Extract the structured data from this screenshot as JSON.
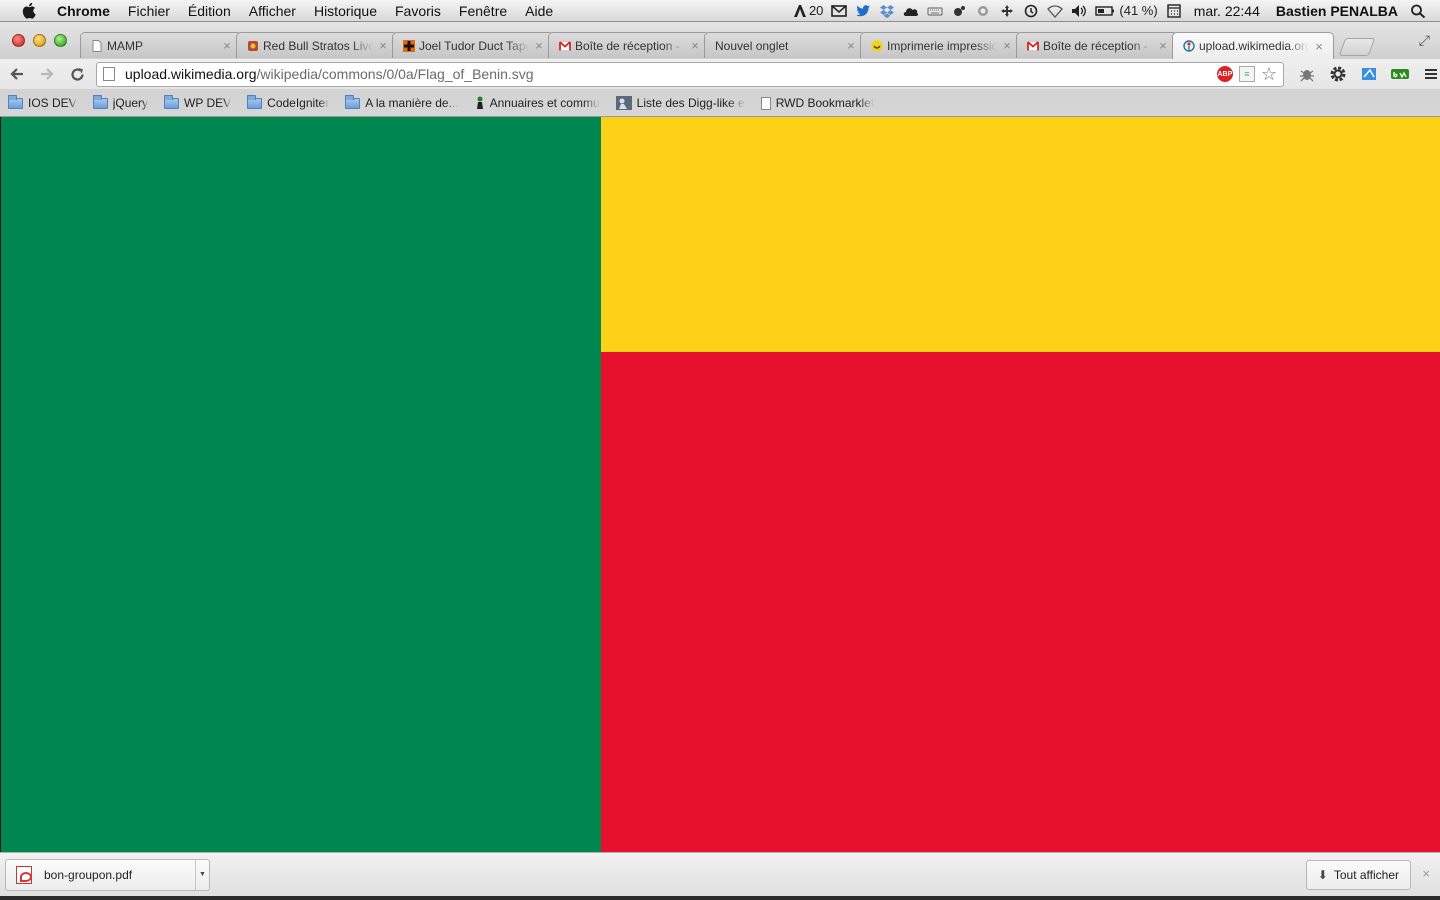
{
  "menubar": {
    "app_name": "Chrome",
    "menus": [
      "Fichier",
      "Édition",
      "Afficher",
      "Historique",
      "Favoris",
      "Fenêtre",
      "Aide"
    ],
    "tray_adobe_count": "20",
    "battery_text": "(41 %)",
    "clock": "mar. 22:44",
    "user": "Bastien PENALBA",
    "tray_icons": [
      "adobe-icon",
      "mail-icon",
      "twitter-icon",
      "dropbox-icon",
      "cloud-icon",
      "keyboard-icon",
      "bluetooth-icon",
      "sync-icon",
      "move-icon",
      "time-machine-icon",
      "wifi-icon",
      "volume-icon",
      "battery-icon",
      "calendar-icon",
      "spotlight-icon"
    ]
  },
  "tabs": [
    {
      "title": "MAMP",
      "favicon": "page-icon",
      "active": false
    },
    {
      "title": "Red Bull Stratos Live",
      "favicon": "redbull-icon",
      "active": false
    },
    {
      "title": "Joel Tudor Duct Tape",
      "favicon": "cross-icon",
      "active": false
    },
    {
      "title": "Boîte de réception - ",
      "favicon": "gmail-icon",
      "active": false
    },
    {
      "title": "Nouvel onglet",
      "favicon": "none",
      "active": false
    },
    {
      "title": "Imprimerie impressio",
      "favicon": "smiley-icon",
      "active": false
    },
    {
      "title": "Boîte de réception - ",
      "favicon": "gmail-icon",
      "active": false
    },
    {
      "title": "upload.wikimedia.org",
      "favicon": "wikimedia-icon",
      "active": true
    }
  ],
  "address_bar": {
    "host": "upload.wikimedia.org",
    "path": "/wikipedia/commons/0/0a/Flag_of_Benin.svg"
  },
  "bookmarks": [
    {
      "label": "IOS DEV",
      "icon": "folder-icon"
    },
    {
      "label": "jQuery",
      "icon": "folder-icon"
    },
    {
      "label": "WP DEV",
      "icon": "folder-icon"
    },
    {
      "label": "CodeIgniter",
      "icon": "folder-icon"
    },
    {
      "label": "A la manière de...",
      "icon": "folder-icon"
    },
    {
      "label": "Annuaires et commu",
      "icon": "figure-icon"
    },
    {
      "label": "Liste des Digg-like e",
      "icon": "digg-icon"
    },
    {
      "label": "RWD Bookmarklet",
      "icon": "page-icon"
    }
  ],
  "flag": {
    "green": "#00874f",
    "yellow": "#fcd116",
    "red": "#e8112d"
  },
  "download_shelf": {
    "file_name": "bon-groupon.pdf",
    "show_all_label": "Tout afficher"
  }
}
